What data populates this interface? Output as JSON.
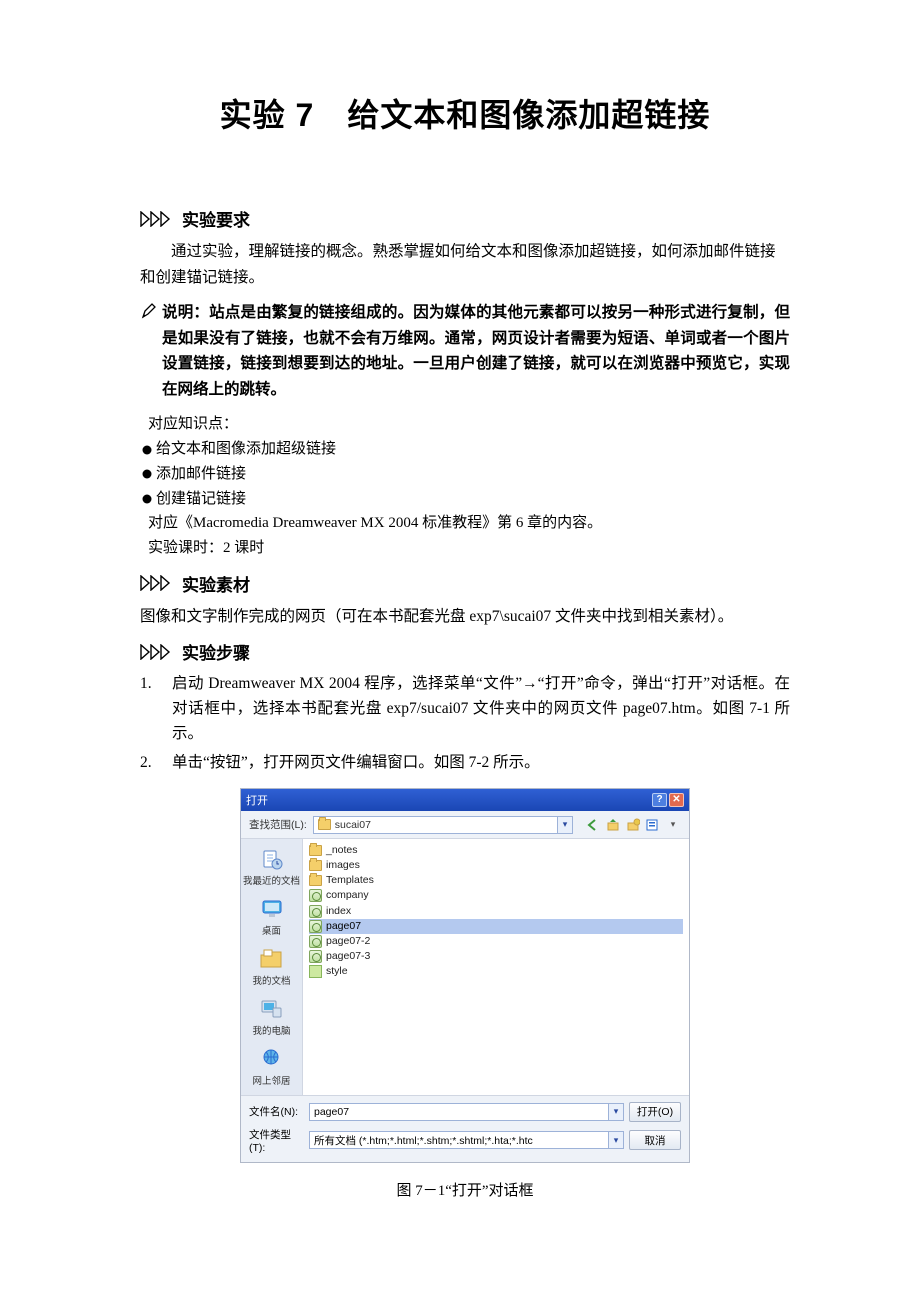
{
  "title": "实验 7　给文本和图像添加超链接",
  "sections": {
    "req": "实验要求",
    "mat": "实验素材",
    "step": "实验步骤"
  },
  "req_para": "通过实验，理解链接的概念。熟悉掌握如何给文本和图像添加超链接，如何添加邮件链接和创建锚记链接。",
  "note_bold_lead": "说明：站点是由繁复的链接组成的。因为媒体的其他元素都可以按另一种形式进行复制，但是如果没有了链接，也就不会有万维网。通常，网页设计者需要为短语、单词或者一个图片设置链接，链接到想要到达的地址。一旦用户创建了链接，就可以在浏览器中预览它，实现在网络上的跳转。",
  "knowledge": {
    "label": "对应知识点：",
    "b1": "给文本和图像添加超级链接",
    "b2": "添加邮件链接",
    "b3": "创建锚记链接",
    "ref": "对应《Macromedia Dreamweaver MX 2004 标准教程》第 6 章的内容。",
    "hours": "实验课时：2 课时"
  },
  "mat_para": "图像和文字制作完成的网页（可在本书配套光盘 exp7\\sucai07 文件夹中找到相关素材）。",
  "steps": {
    "s1": "启动 Dreamweaver MX 2004 程序，选择菜单“文件”→“打开”命令，弹出“打开”对话框。在对话框中，选择本书配套光盘 exp7/sucai07 文件夹中的网页文件 page07.htm。如图 7-1 所示。",
    "s2": "单击“按钮”，打开网页文件编辑窗口。如图 7-2 所示。"
  },
  "dialog": {
    "title": "打开",
    "lookin_label": "查找范围(L):",
    "lookin_value": "sucai07",
    "places": {
      "recent": "我最近的文档",
      "desktop": "桌面",
      "docs": "我的文档",
      "pc": "我的电脑",
      "net": "网上邻居"
    },
    "files": {
      "f0": "_notes",
      "f1": "images",
      "f2": "Templates",
      "f3": "company",
      "f4": "index",
      "f5": "page07",
      "f6": "page07-2",
      "f7": "page07-3",
      "f8": "style"
    },
    "fn_label": "文件名(N):",
    "fn_value": "page07",
    "ft_label": "文件类型(T):",
    "ft_value": "所有文档 (*.htm;*.html;*.shtm;*.shtml;*.hta;*.htc",
    "open_btn": "打开(O)",
    "cancel_btn": "取消"
  },
  "caption": "图 7－1“打开”对话框"
}
